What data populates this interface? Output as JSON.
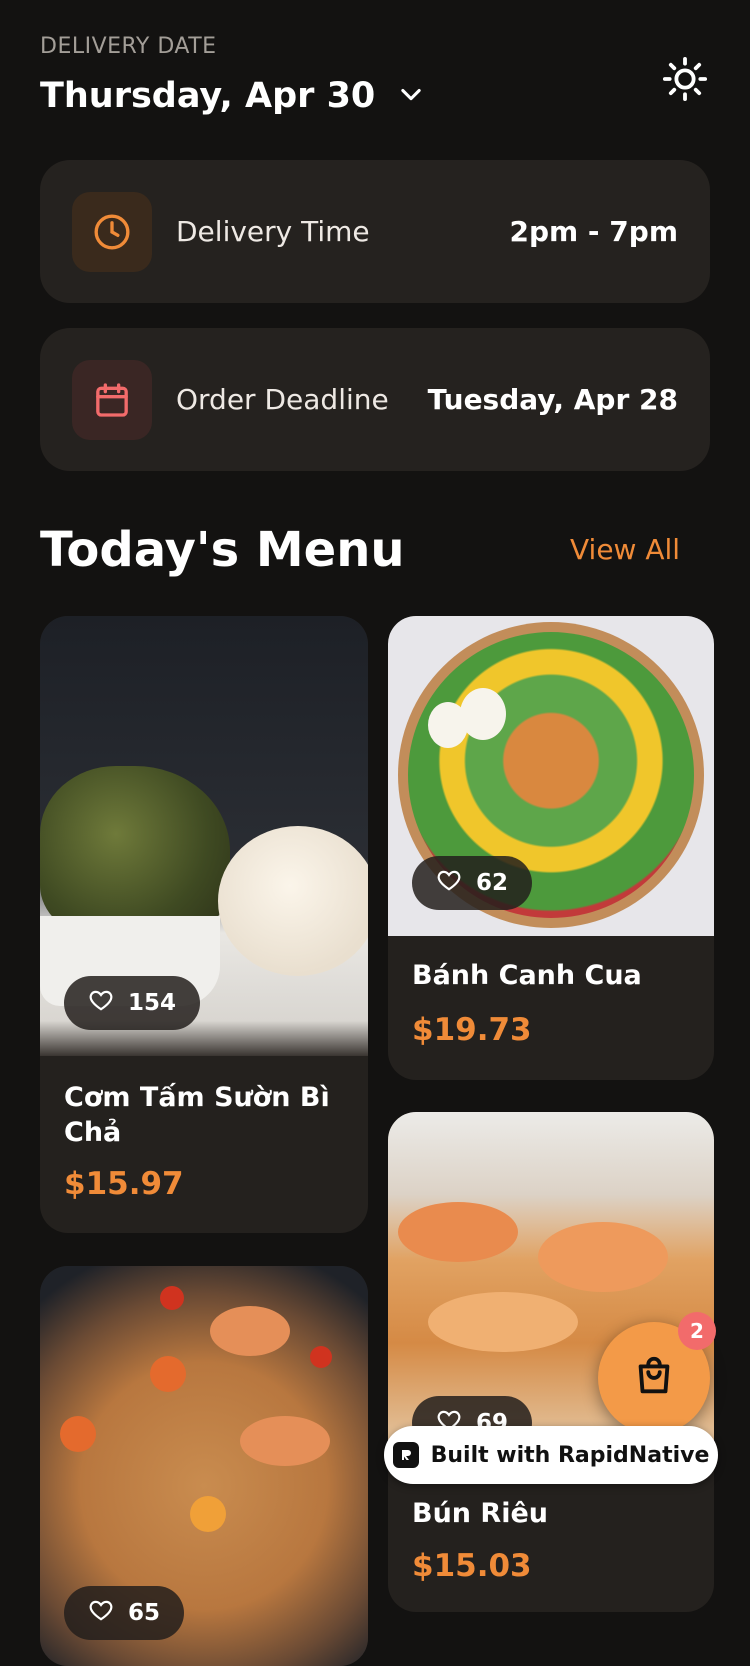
{
  "header": {
    "delivery_label": "DELIVERY DATE",
    "delivery_date": "Thursday, Apr 30"
  },
  "info_cards": [
    {
      "label": "Delivery Time",
      "value": "2pm - 7pm",
      "icon": "clock-icon",
      "accent": "#f08b38"
    },
    {
      "label": "Order Deadline",
      "value": "Tuesday, Apr 28",
      "icon": "calendar-icon",
      "accent": "#f26b6b"
    }
  ],
  "menu": {
    "title": "Today's Menu",
    "view_all": "View All",
    "items": [
      {
        "name": "Cơm Tấm Sườn Bì Chả",
        "price": "$15.97",
        "likes": "154"
      },
      {
        "name": "Bánh Canh Cua",
        "price": "$19.73",
        "likes": "62"
      },
      {
        "name": "Bún Riêu",
        "price": "$15.03",
        "likes": "69"
      },
      {
        "name": "",
        "price": "",
        "likes": "65"
      }
    ]
  },
  "cart": {
    "count": "2",
    "icon": "shopping-bag-icon"
  },
  "badge": {
    "text": "Built with RapidNative"
  },
  "colors": {
    "accent": "#f08b38",
    "background": "#131211",
    "card": "#24211e",
    "badge": "#f26b6b"
  }
}
